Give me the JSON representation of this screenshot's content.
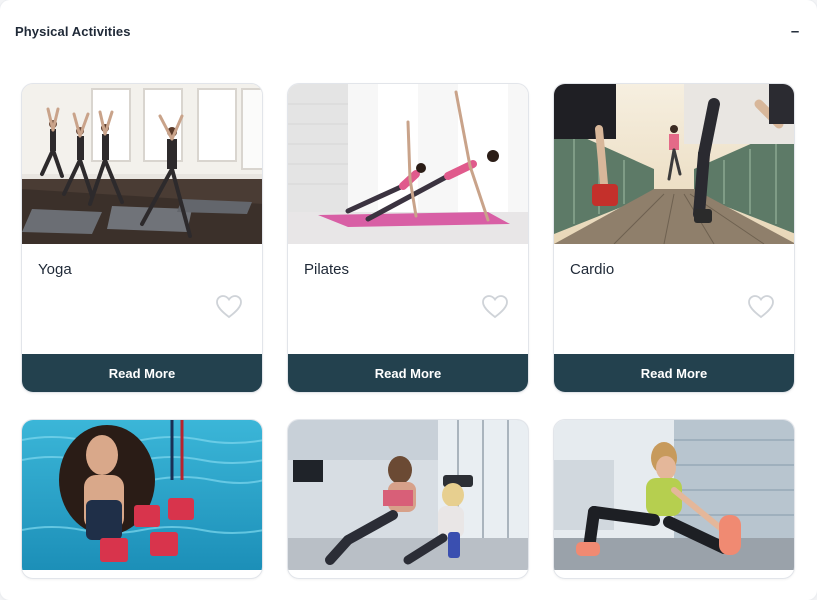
{
  "panel": {
    "title": "Physical Activities",
    "collapse_symbol": "–"
  },
  "cards": [
    {
      "title": "Yoga",
      "button": "Read More",
      "favorite_icon": "heart-outline-icon"
    },
    {
      "title": "Pilates",
      "button": "Read More",
      "favorite_icon": "heart-outline-icon"
    },
    {
      "title": "Cardio",
      "button": "Read More",
      "favorite_icon": "heart-outline-icon"
    },
    {
      "title": "",
      "button": "",
      "favorite_icon": ""
    },
    {
      "title": "",
      "button": "",
      "favorite_icon": ""
    },
    {
      "title": "",
      "button": "",
      "favorite_icon": ""
    }
  ],
  "colors": {
    "button_bg": "#23414e",
    "heart_stroke": "#cfd3d8"
  }
}
